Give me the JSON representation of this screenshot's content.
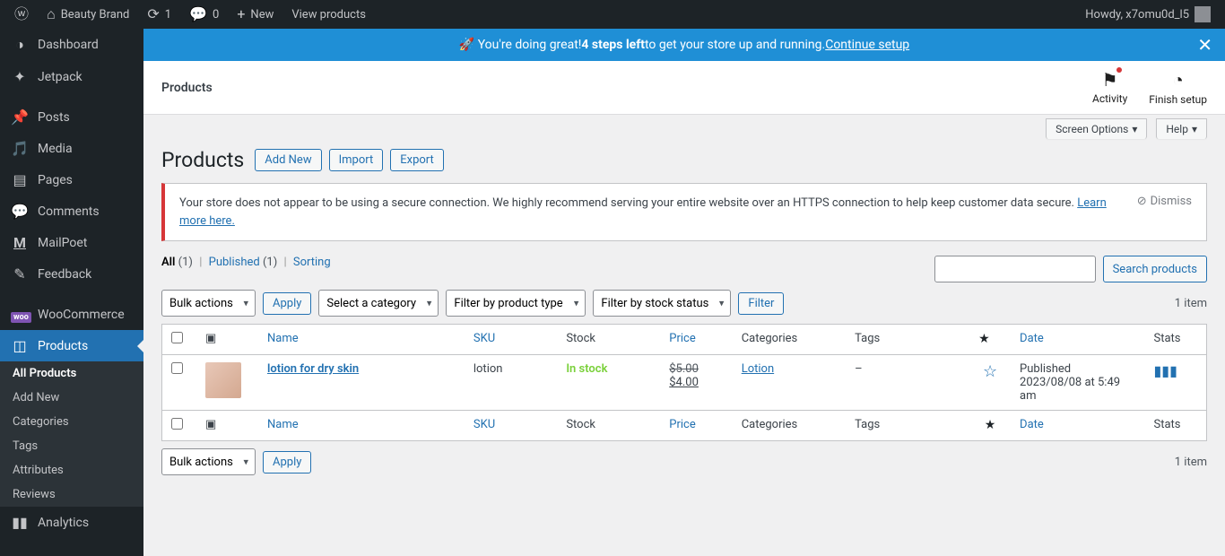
{
  "adminbar": {
    "site_name": "Beauty Brand",
    "updates": "1",
    "comments": "0",
    "new_label": "New",
    "view_products": "View products",
    "howdy": "Howdy, x7omu0d_l5"
  },
  "sidebar": {
    "items": [
      {
        "icon": "◐",
        "label": "Dashboard"
      },
      {
        "icon": "✦",
        "label": "Jetpack"
      },
      {
        "icon": "📌",
        "label": "Posts"
      },
      {
        "icon": "🎵",
        "label": "Media"
      },
      {
        "icon": "▤",
        "label": "Pages"
      },
      {
        "icon": "💬",
        "label": "Comments"
      },
      {
        "icon": "M",
        "label": "MailPoet"
      },
      {
        "icon": "✎",
        "label": "Feedback"
      },
      {
        "icon": "woo",
        "label": "WooCommerce"
      },
      {
        "icon": "◫",
        "label": "Products"
      },
      {
        "icon": "▮",
        "label": "Analytics"
      }
    ],
    "submenu": [
      "All Products",
      "Add New",
      "Categories",
      "Tags",
      "Attributes",
      "Reviews"
    ]
  },
  "banner": {
    "prefix": "You're doing great! ",
    "bold": "4 steps left",
    "suffix": " to get your store up and running. ",
    "link": "Continue setup"
  },
  "header": {
    "title": "Products",
    "activity": "Activity",
    "finish": "Finish setup"
  },
  "screen_tabs": {
    "screen_options": "Screen Options",
    "help": "Help"
  },
  "page": {
    "heading": "Products",
    "add_new": "Add New",
    "import": "Import",
    "export": "Export"
  },
  "notice": {
    "text": "Your store does not appear to be using a secure connection. We highly recommend serving your entire website over an HTTPS connection to help keep customer data secure. ",
    "learn": "Learn more here.",
    "dismiss": "Dismiss"
  },
  "subsubsub": {
    "all": "All",
    "all_count": "(1)",
    "published": "Published",
    "published_count": "(1)",
    "sorting": "Sorting"
  },
  "search": {
    "button": "Search products"
  },
  "filters": {
    "bulk": "Bulk actions",
    "apply": "Apply",
    "category": "Select a category",
    "product_type": "Filter by product type",
    "stock_status": "Filter by stock status",
    "filter": "Filter",
    "item_count": "1 item"
  },
  "columns": {
    "name": "Name",
    "sku": "SKU",
    "stock": "Stock",
    "price": "Price",
    "categories": "Categories",
    "tags": "Tags",
    "date": "Date",
    "stats": "Stats"
  },
  "rows": [
    {
      "name": "lotion for dry skin",
      "sku": "lotion",
      "stock": "In stock",
      "price_old": "$5.00",
      "price_new": "$4.00",
      "category": "Lotion",
      "tags": "–",
      "date_status": "Published",
      "date_time": "2023/08/08 at 5:49 am"
    }
  ]
}
